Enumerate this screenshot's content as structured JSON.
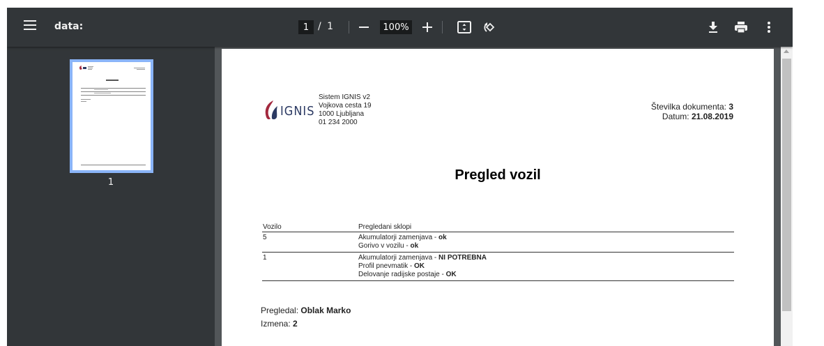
{
  "toolbar": {
    "title": "data:",
    "page_current": "1",
    "page_separator": "/",
    "page_total": "1",
    "zoom": "100%"
  },
  "sidebar": {
    "thumbnail_label": "1"
  },
  "document": {
    "logo_text": "IGNIS",
    "address_lines": [
      "Sistem IGNIS v2",
      "Vojkova cesta 19",
      "1000 Ljubljana",
      "01 234 2000"
    ],
    "doc_number_label": "Številka dokumenta:",
    "doc_number": "3",
    "date_label": "Datum:",
    "date": "21.08.2019",
    "title": "Pregled vozil",
    "table": {
      "headers": [
        "Vozilo",
        "Pregledani sklopi"
      ],
      "rows": [
        {
          "vozilo": "5",
          "items": [
            {
              "name": "Akumulatorji zamenjava - ",
              "status": "ok"
            },
            {
              "name": "Gorivo v vozilu - ",
              "status": "ok"
            }
          ]
        },
        {
          "vozilo": "1",
          "items": [
            {
              "name": "Akumulatorji zamenjava - ",
              "status": "NI POTREBNA"
            },
            {
              "name": "Profil pnevmatik - ",
              "status": "OK"
            },
            {
              "name": "Delovanje radijske postaje - ",
              "status": "OK"
            }
          ]
        }
      ]
    },
    "inspector_label": "Pregledal:",
    "inspector": "Oblak Marko",
    "revision_label": "Izmena:",
    "revision": "2"
  },
  "colors": {
    "toolbar_bg": "#323639",
    "viewer_bg": "#525659",
    "thumb_highlight": "#8ab4f8",
    "logo_red": "#a3293e",
    "logo_navy": "#2c3a63"
  },
  "icons": [
    "menu-icon",
    "zoom-out-icon",
    "zoom-in-icon",
    "fit-page-icon",
    "rotate-icon",
    "download-icon",
    "print-icon",
    "more-vert-icon"
  ]
}
